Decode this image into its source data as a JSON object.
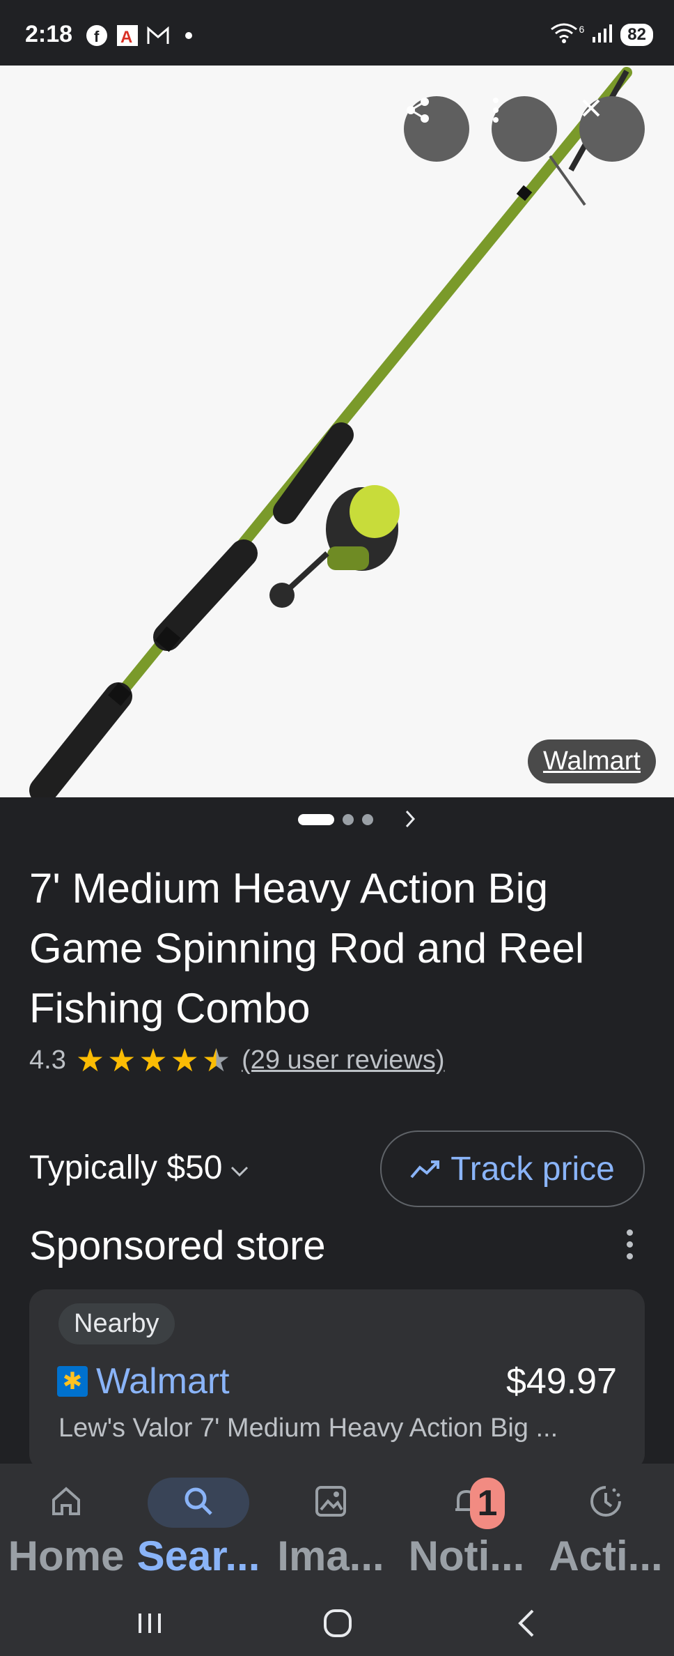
{
  "status_bar": {
    "time": "2:18",
    "notification_icons": [
      "facebook-icon",
      "news-app-icon",
      "gmail-icon",
      "dot-icon"
    ],
    "signal_label": "6",
    "battery": "82"
  },
  "hero": {
    "source_label": "Walmart",
    "buttons": [
      "share-icon",
      "more-vertical-icon",
      "close-icon"
    ],
    "carousel": {
      "total": 3,
      "active_index": 0
    }
  },
  "product": {
    "title": "7' Medium Heavy Action Big Game Spinning Rod and Reel Fishing Combo",
    "rating_value": "4.3",
    "rating": 4.3,
    "reviews_label": "(29 user reviews)"
  },
  "pricing": {
    "typically_label": "Typically $50",
    "track_label": "Track price"
  },
  "section": {
    "title": "Sponsored store"
  },
  "store": {
    "badge": "Nearby",
    "name": "Walmart",
    "price": "$49.97",
    "description": "Lew's Valor 7' Medium Heavy Action Big ..."
  },
  "bottom_nav": {
    "items": [
      {
        "label": "Home",
        "icon": "home-icon"
      },
      {
        "label": "Sear...",
        "icon": "search-icon"
      },
      {
        "label": "Ima...",
        "icon": "images-icon"
      },
      {
        "label": "Noti...",
        "icon": "bell-icon",
        "badge": "1"
      },
      {
        "label": "Acti...",
        "icon": "activity-icon"
      }
    ],
    "active_index": 1
  },
  "colors": {
    "background": "#202124",
    "accent_blue": "#8ab4f8",
    "star_yellow": "#fbbc04",
    "rod_green": "#7a9a2a"
  }
}
